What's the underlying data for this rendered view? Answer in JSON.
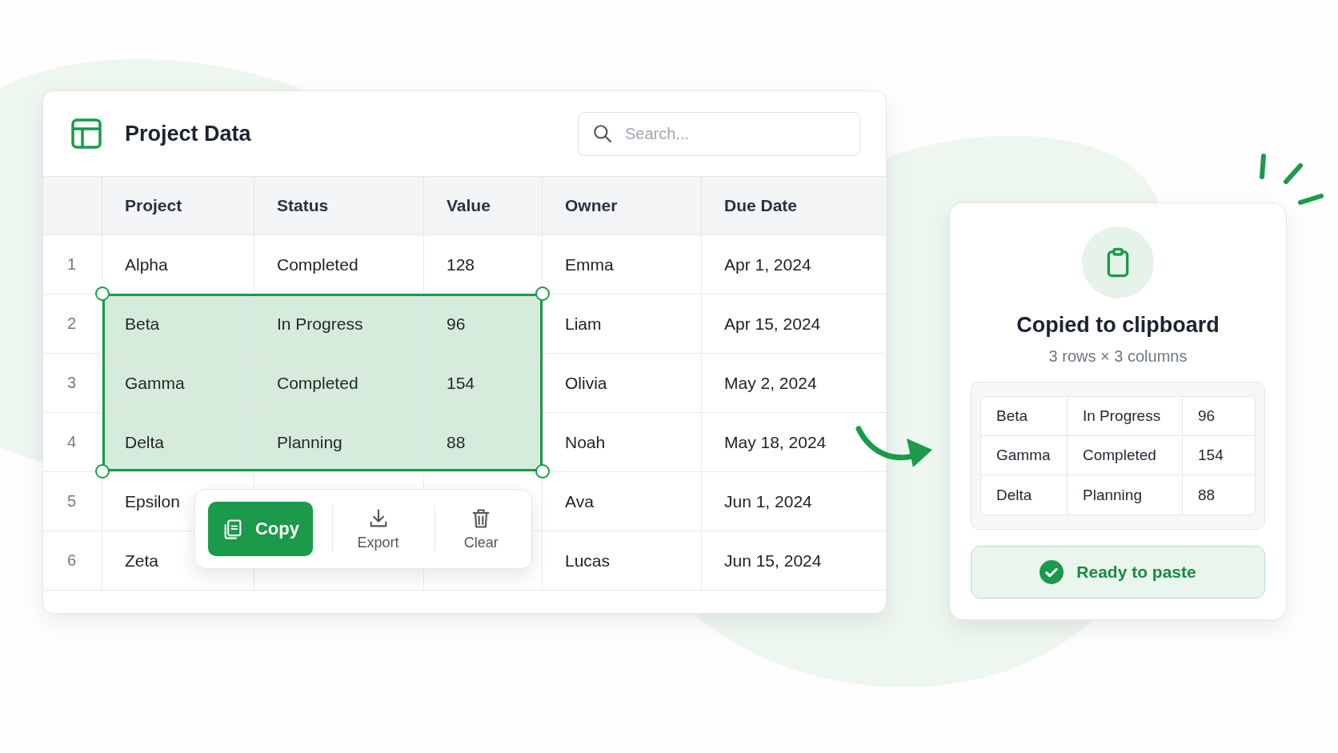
{
  "table_panel": {
    "title": "Project Data",
    "search": {
      "placeholder": "Search..."
    },
    "columns": [
      {
        "label": "Project",
        "selected": true
      },
      {
        "label": "Status",
        "selected": true
      },
      {
        "label": "Value",
        "selected": true
      },
      {
        "label": "Owner",
        "selected": false
      },
      {
        "label": "Due Date",
        "selected": false
      }
    ],
    "rows": [
      {
        "number": "1",
        "cells": [
          "Alpha",
          "Completed",
          "128",
          "Emma",
          "Apr 1, 2024"
        ],
        "selected": false
      },
      {
        "number": "2",
        "cells": [
          "Beta",
          "In Progress",
          "96",
          "Liam",
          "Apr 15, 2024"
        ],
        "selected": true
      },
      {
        "number": "3",
        "cells": [
          "Gamma",
          "Completed",
          "154",
          "Olivia",
          "May 2, 2024"
        ],
        "selected": true
      },
      {
        "number": "4",
        "cells": [
          "Delta",
          "Planning",
          "88",
          "Noah",
          "May 18, 2024"
        ],
        "selected": true
      },
      {
        "number": "5",
        "cells": [
          "Epsilon",
          "",
          "",
          "Ava",
          "Jun 1, 2024"
        ],
        "selected": false
      },
      {
        "number": "6",
        "cells": [
          "Zeta",
          "",
          "",
          "Lucas",
          "Jun 15, 2024"
        ],
        "selected": false
      }
    ],
    "selection_toolbar": {
      "actions": [
        {
          "label": "Copy",
          "kind": "primary"
        },
        {
          "label": "Export",
          "kind": "export"
        },
        {
          "label": "Clear",
          "kind": "clear"
        }
      ]
    }
  },
  "clipboard_panel": {
    "title": "Copied to clipboard",
    "subtitle": "3 rows × 3 columns",
    "rows": [
      [
        "Beta",
        "In Progress",
        "96"
      ],
      [
        "Gamma",
        "Completed",
        "154"
      ],
      [
        "Delta",
        "Planning",
        "88"
      ]
    ],
    "status": "Ready to paste"
  }
}
